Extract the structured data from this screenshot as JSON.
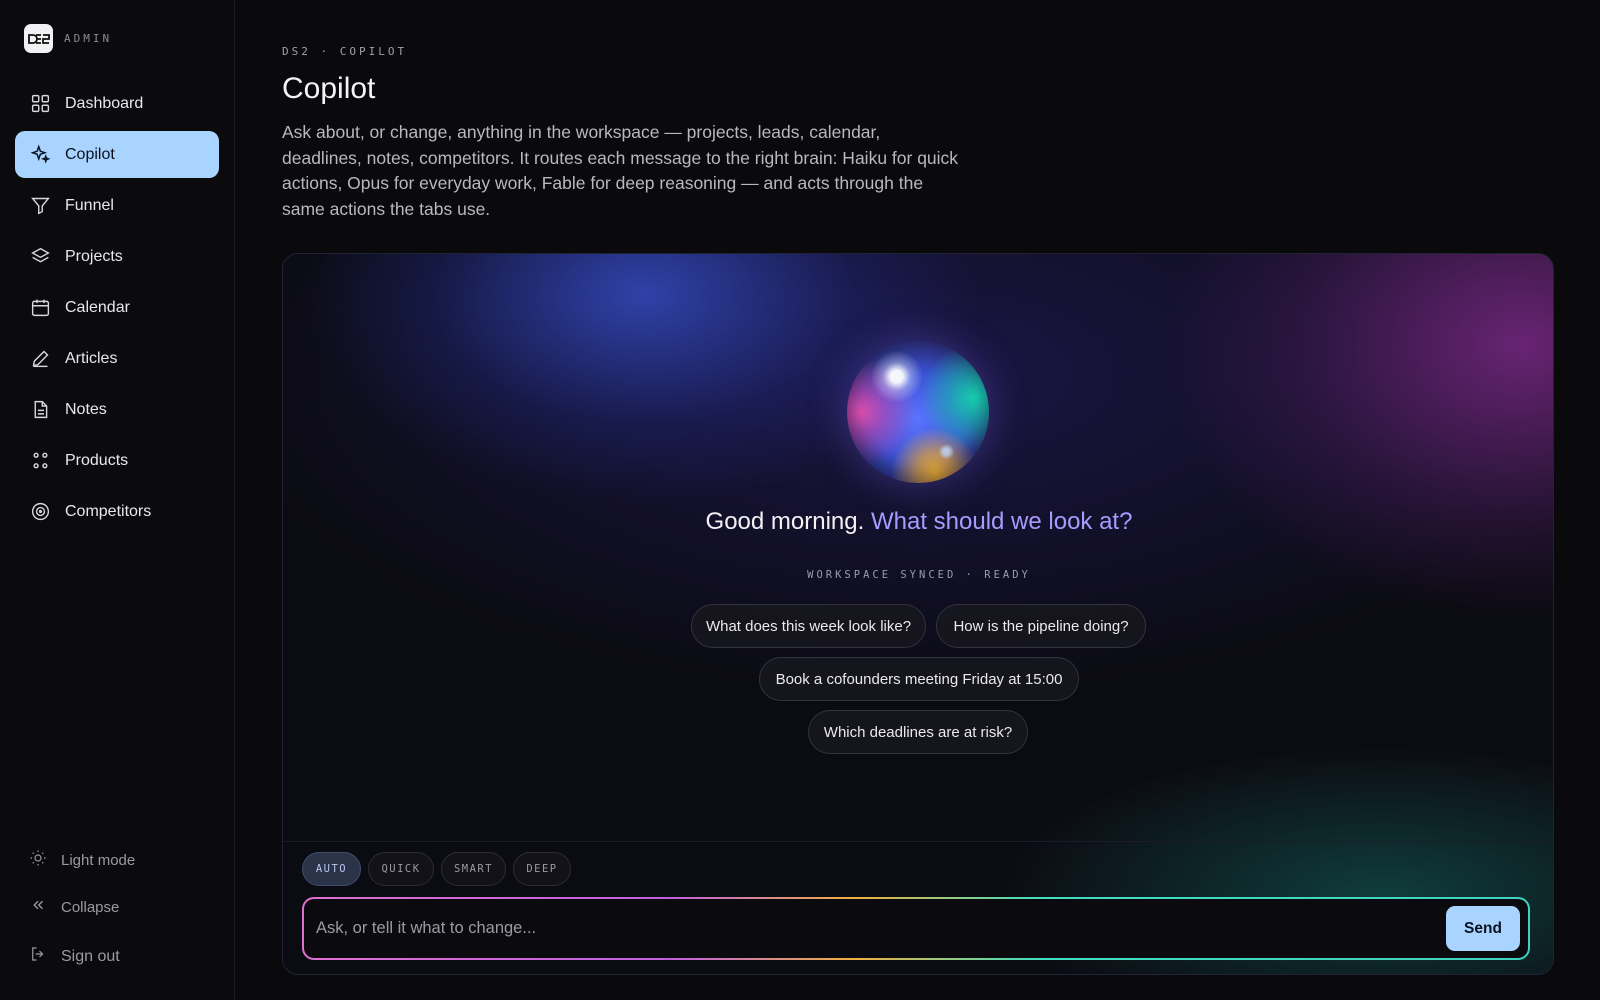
{
  "sidebar": {
    "brand_logo_text": "DS2",
    "brand_label": "ADMIN",
    "items": [
      {
        "label": "Dashboard",
        "icon": "grid-icon"
      },
      {
        "label": "Copilot",
        "icon": "sparkle-icon",
        "active": true
      },
      {
        "label": "Funnel",
        "icon": "funnel-icon"
      },
      {
        "label": "Projects",
        "icon": "layers-icon"
      },
      {
        "label": "Calendar",
        "icon": "calendar-icon"
      },
      {
        "label": "Articles",
        "icon": "pen-icon"
      },
      {
        "label": "Notes",
        "icon": "document-icon"
      },
      {
        "label": "Products",
        "icon": "dots-icon"
      },
      {
        "label": "Competitors",
        "icon": "target-icon"
      }
    ],
    "light_mode_label": "Light mode",
    "collapse_label": "Collapse",
    "sign_out_label": "Sign out"
  },
  "header": {
    "eyebrow": "DS2 · COPILOT",
    "title": "Copilot",
    "description": "Ask about, or change, anything in the workspace — projects, leads, calendar, deadlines, notes, competitors. It routes each message to the right brain: Haiku for quick actions, Opus for everyday work, Fable for deep reasoning — and acts through the same actions the tabs use."
  },
  "panel": {
    "greeting": "Good morning.",
    "greeting_accent": "What should we look at?",
    "status": "WORKSPACE SYNCED · READY",
    "suggestions": [
      "What does this week look like?",
      "How is the pipeline doing?",
      "Book a cofounders meeting Friday at 15:00",
      "Which deadlines are at risk?"
    ],
    "modes": [
      "AUTO",
      "QUICK",
      "SMART",
      "DEEP"
    ],
    "active_mode": "AUTO",
    "input_placeholder": "Ask, or tell it what to change...",
    "send_label": "Send"
  },
  "colors": {
    "accent": "#a9d4ff",
    "greeting_accent": "#a89bff",
    "background": "#0a0a0c"
  }
}
